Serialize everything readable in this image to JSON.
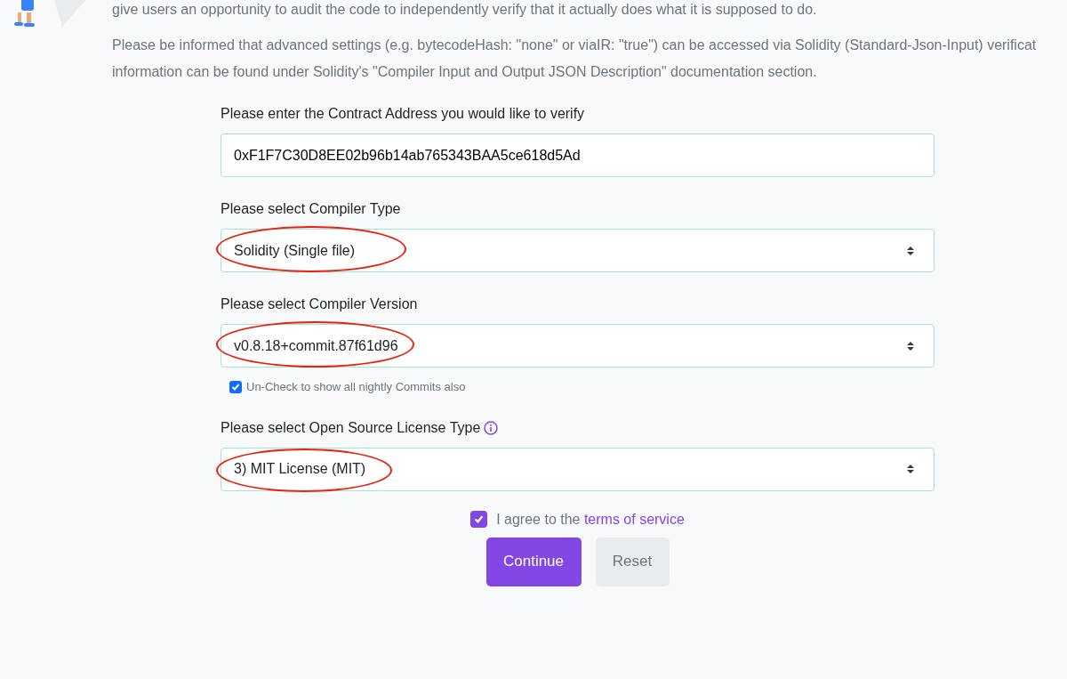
{
  "intro": {
    "lines": [
      "give users an opportunity to audit the code to independently verify that it actually does what it is supposed to do.",
      "Please be informed that advanced settings (e.g. bytecodeHash: \"none\" or viaIR: \"true\") can be accessed via Solidity (Standard-Json-Input) verificat",
      "information can be found under Solidity's \"Compiler Input and Output JSON Description\" documentation section."
    ]
  },
  "form": {
    "address": {
      "label": "Please enter the Contract Address you would like to verify",
      "value": "0xF1F7C30D8EE02b96b14ab765343BAA5ce618d5Ad"
    },
    "fields": [
      {
        "kind": "select",
        "label": "Please select Compiler Type",
        "value": "Solidity (Single file)",
        "circled": true
      },
      {
        "kind": "select",
        "label": "Please select Compiler Version",
        "value": "v0.8.18+commit.87f61d96",
        "circled": true,
        "option": {
          "label": "Un-Check to show all nightly Commits also",
          "checked": true
        }
      },
      {
        "kind": "select",
        "label": "Please select Open Source License Type",
        "value": "3) MIT License (MIT)",
        "circled": true,
        "info": true
      }
    ],
    "agree": {
      "text": "I agree to the ",
      "link": "terms of service",
      "checked": true
    },
    "buttons": [
      {
        "label": "Continue",
        "kind": "primary"
      },
      {
        "label": "Reset",
        "kind": "secondary"
      }
    ]
  }
}
